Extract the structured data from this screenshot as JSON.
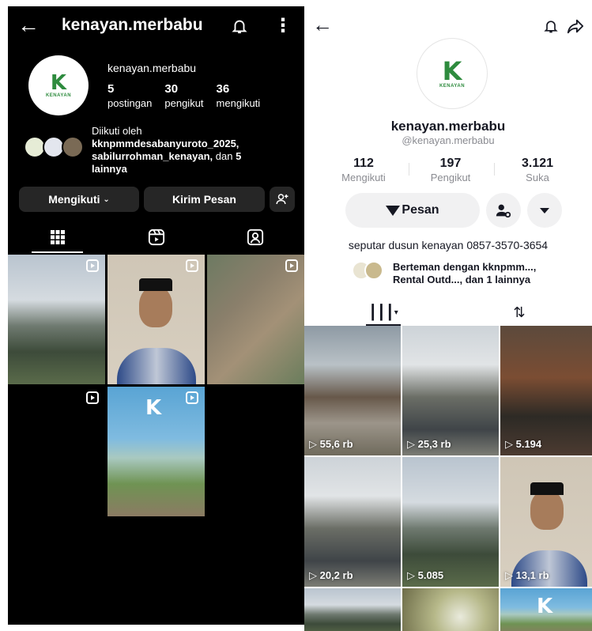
{
  "instagram": {
    "title": "kenayan.merbabu",
    "username": "kenayan.merbabu",
    "stats": [
      {
        "value": "5",
        "label": "postingan"
      },
      {
        "value": "30",
        "label": "pengikut"
      },
      {
        "value": "36",
        "label": "mengikuti"
      }
    ],
    "followed_by_intro": "Diikuti oleh",
    "followed_by_bold": "kknpmmdesabanyuroto_2025, sabilurrohman_kenayan,",
    "followed_by_mid": " dan ",
    "followed_by_more_bold": "5 lainnya",
    "follow_button": "Mengikuti",
    "message_button": "Kirim Pesan",
    "logo_word": "KENAYAN"
  },
  "tiktok": {
    "name": "kenayan.merbabu",
    "handle": "@kenayan.merbabu",
    "stats": [
      {
        "value": "112",
        "label": "Mengikuti"
      },
      {
        "value": "197",
        "label": "Pengikut"
      },
      {
        "value": "3.121",
        "label": "Suka"
      }
    ],
    "message_button": "Pesan",
    "bio": "seputar dusun kenayan  0857-3570-3654",
    "friends_line1": "Berteman dengan kknpmm...,",
    "friends_line2": "Rental Outd..., dan 1 lainnya",
    "logo_word": "KENAYAN",
    "video_views": [
      "55,6 rb",
      "25,3 rb",
      "5.194",
      "20,2 rb",
      "5.085",
      "13,1 rb"
    ]
  }
}
